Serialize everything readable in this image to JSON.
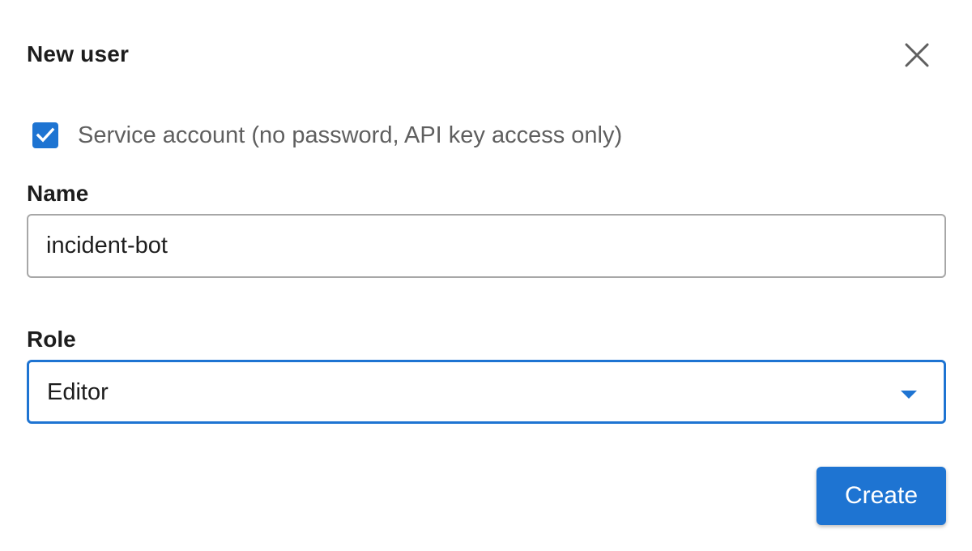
{
  "dialog": {
    "title": "New user",
    "close_icon": "close-icon"
  },
  "service_account": {
    "checked": true,
    "label": "Service account (no password, API key access only)",
    "icon": "check-icon"
  },
  "name_field": {
    "label": "Name",
    "value": "incident-bot"
  },
  "role_field": {
    "label": "Role",
    "selected": "Editor",
    "icon": "chevron-down-icon"
  },
  "actions": {
    "create_label": "Create"
  },
  "colors": {
    "accent": "#1e74d2",
    "text": "#1d1d1d",
    "muted_text": "#5f5f5f",
    "input_border": "#a7a7a7"
  }
}
